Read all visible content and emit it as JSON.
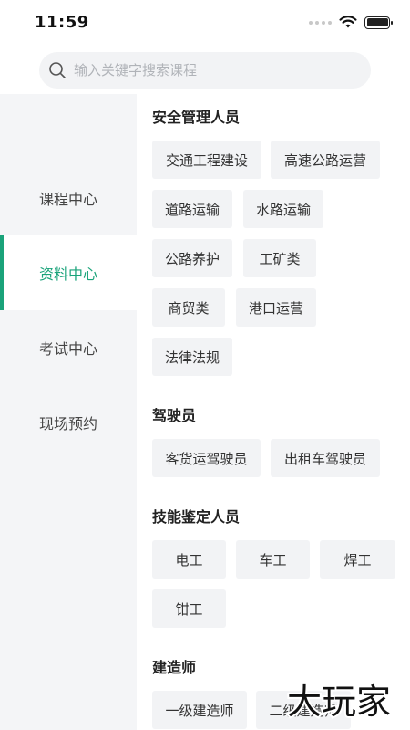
{
  "status_bar": {
    "time": "11:59"
  },
  "search": {
    "placeholder": "输入关键字搜索课程",
    "value": ""
  },
  "sidebar": {
    "items": [
      {
        "label": "课程中心",
        "active": false
      },
      {
        "label": "资料中心",
        "active": true
      },
      {
        "label": "考试中心",
        "active": false
      },
      {
        "label": "现场预约",
        "active": false
      }
    ]
  },
  "sections": [
    {
      "title": "安全管理人员",
      "tags": [
        "交通工程建设",
        "高速公路运营",
        "道路运输",
        "水路运输",
        "公路养护",
        "工矿类",
        "商贸类",
        "港口运营",
        "法律法规"
      ]
    },
    {
      "title": "驾驶员",
      "tags": [
        "客货运驾驶员",
        "出租车驾驶员"
      ]
    },
    {
      "title": "技能鉴定人员",
      "tags": [
        "电工",
        "车工",
        "焊工",
        "钳工"
      ]
    },
    {
      "title": "建造师",
      "tags": [
        "一级建造师",
        "二级建造师"
      ]
    }
  ],
  "watermark": {
    "text": "大玩家"
  },
  "colors": {
    "accent": "#1aa37a",
    "sidebar_bg": "#f4f5f7",
    "tag_bg": "#f2f3f5",
    "search_bg": "#f2f3f5"
  }
}
